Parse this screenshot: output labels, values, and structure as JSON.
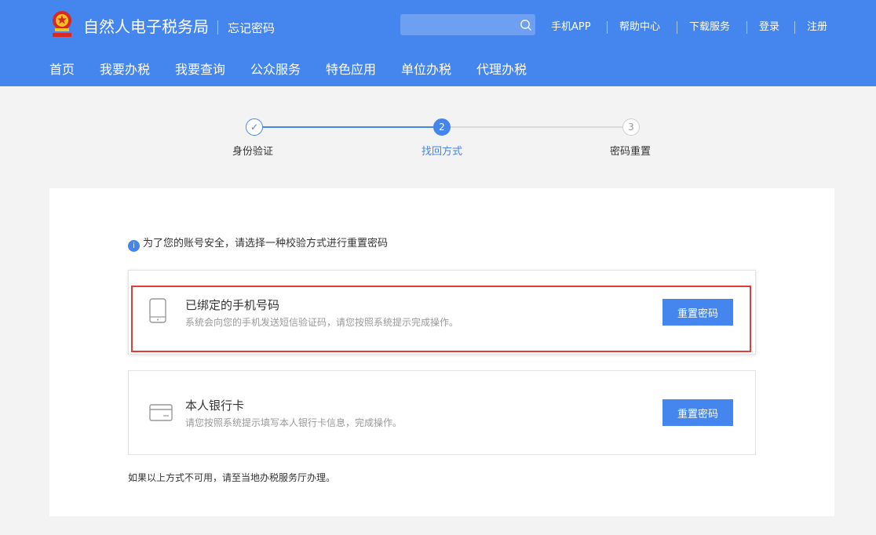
{
  "header": {
    "brand": "自然人电子税务局",
    "subtitle": "忘记密码",
    "search": {
      "placeholder": "",
      "icon": "search-icon"
    },
    "links": [
      "手机APP",
      "帮助中心",
      "下载服务",
      "登录",
      "注册"
    ]
  },
  "nav": [
    "首页",
    "我要办税",
    "我要查询",
    "公众服务",
    "特色应用",
    "单位办税",
    "代理办税"
  ],
  "steps": [
    {
      "label": "身份验证",
      "marker": "✓",
      "state": "done"
    },
    {
      "label": "找回方式",
      "marker": "2",
      "state": "current"
    },
    {
      "label": "密码重置",
      "marker": "3",
      "state": "pending"
    }
  ],
  "main": {
    "notice": "为了您的账号安全，请选择一种校验方式进行重置密码",
    "info_icon": "i",
    "options": [
      {
        "title": "已绑定的手机号码",
        "desc": "系统会向您的手机发送短信验证码，请您按照系统提示完成操作。",
        "button": "重置密码",
        "icon": "phone-icon",
        "highlighted": true
      },
      {
        "title": "本人银行卡",
        "desc": "请您按照系统提示填写本人银行卡信息，完成操作。",
        "button": "重置密码",
        "icon": "bank-card-icon",
        "highlighted": false
      }
    ],
    "footer": "如果以上方式不可用，请至当地办税服务厅办理。"
  },
  "colors": {
    "primary": "#4585ee",
    "highlight_border": "#e23b3b",
    "background": "#f3f3f3"
  }
}
